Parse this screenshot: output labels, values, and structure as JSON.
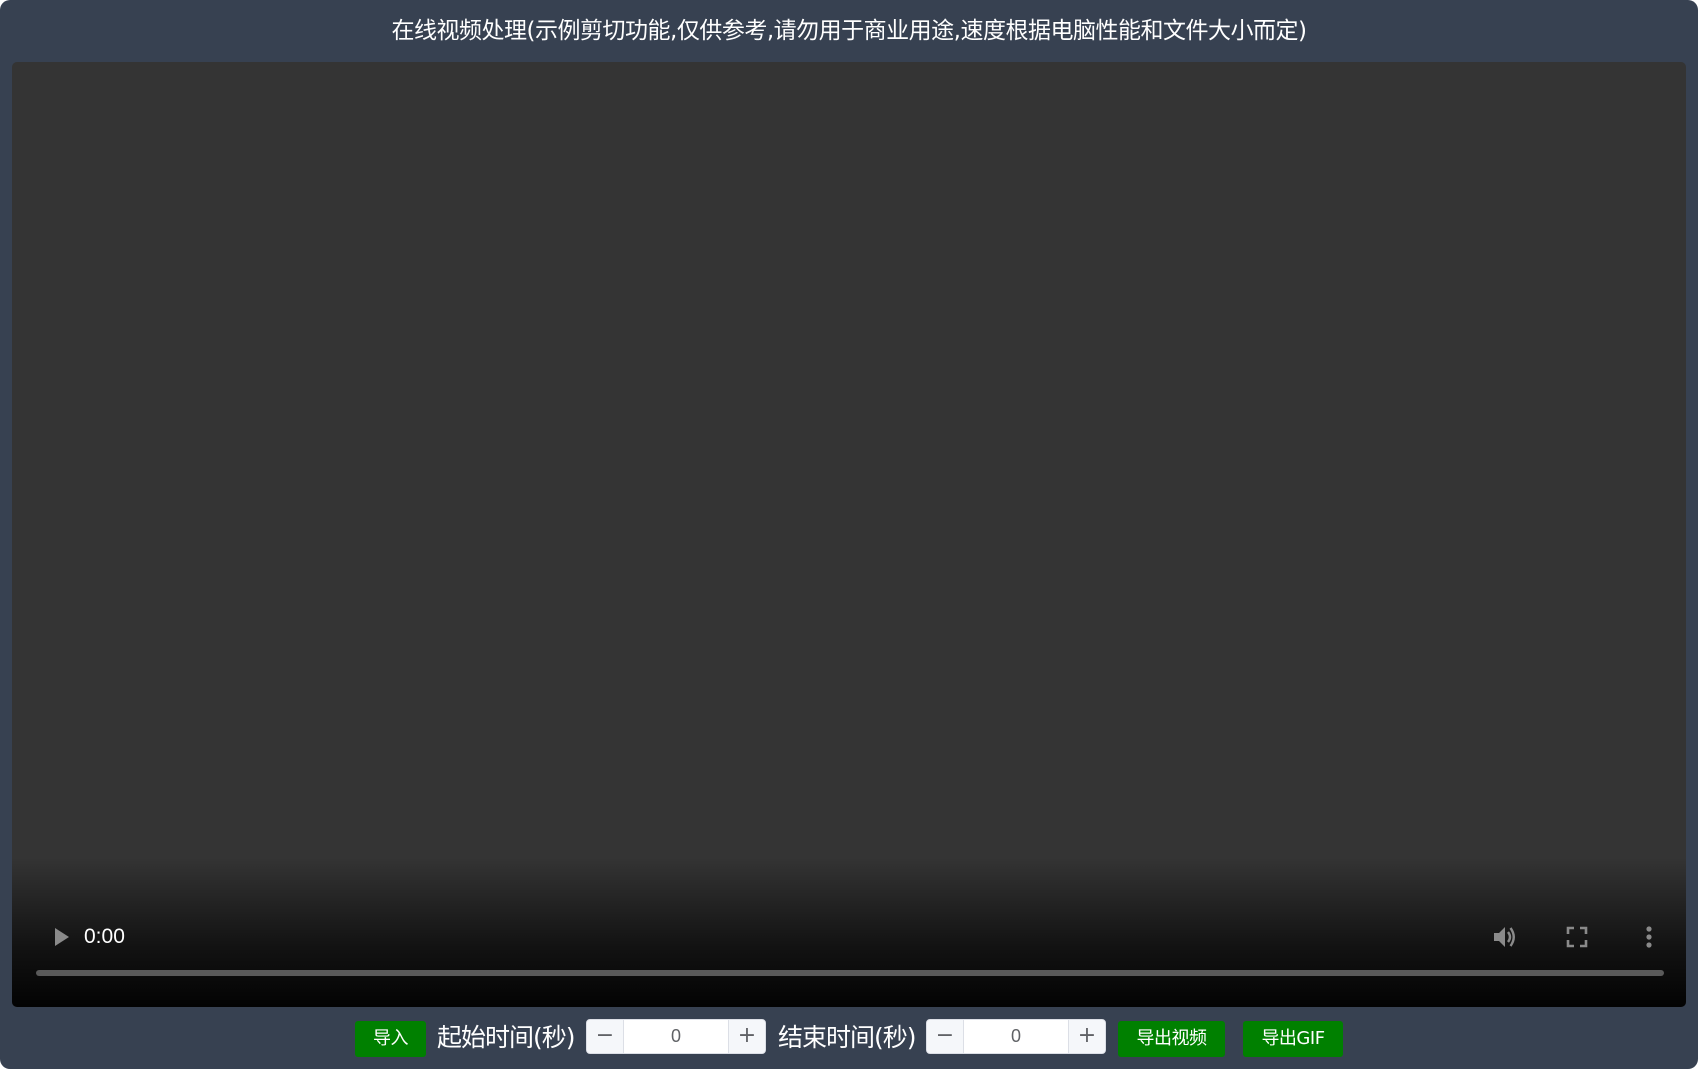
{
  "header": {
    "title": "在线视频处理(示例剪切功能,仅供参考,请勿用于商业用途,速度根据电脑性能和文件大小而定)"
  },
  "player": {
    "current_time": "0:00",
    "progress": 0,
    "icons": {
      "play": "play-icon",
      "volume": "volume-icon",
      "fullscreen": "fullscreen-icon",
      "more": "more-vertical-icon"
    }
  },
  "toolbar": {
    "import_label": "导入",
    "start_label": "起始时间(秒)",
    "start_value": "0",
    "end_label": "结束时间(秒)",
    "end_value": "0",
    "minus_symbol": "−",
    "plus_symbol": "+",
    "export_video_label": "导出视频",
    "export_gif_label": "导出GIF"
  },
  "colors": {
    "page_background": "#374151",
    "video_background": "#343434",
    "button_green": "#008000",
    "text": "#ffffff"
  }
}
